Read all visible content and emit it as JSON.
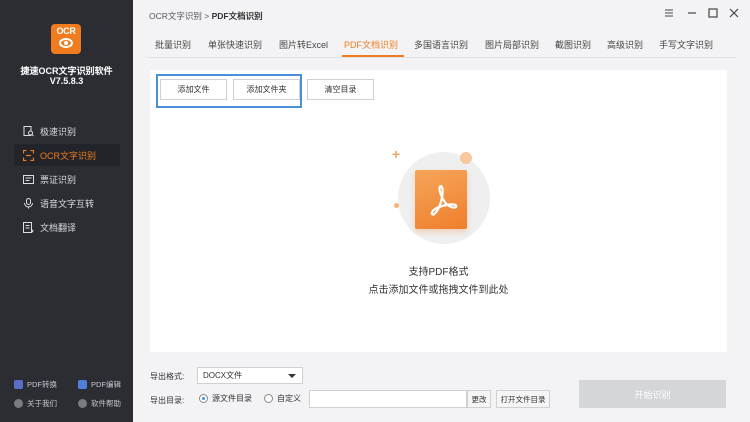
{
  "sidebar": {
    "logo_text": "OCR",
    "app_name": "捷速OCR文字识别软件",
    "version": "V7.5.8.3",
    "items": [
      {
        "label": "极速识别",
        "icon": "doc-search-icon",
        "active": false
      },
      {
        "label": "OCR文字识别",
        "icon": "scan-frame-icon",
        "active": true
      },
      {
        "label": "票证识别",
        "icon": "ticket-icon",
        "active": false
      },
      {
        "label": "语音文字互转",
        "icon": "microphone-icon",
        "active": false
      },
      {
        "label": "文档翻译",
        "icon": "translate-doc-icon",
        "active": false
      }
    ],
    "footer": [
      {
        "label": "PDF转换",
        "icon": "pdf-convert-icon"
      },
      {
        "label": "PDF编辑",
        "icon": "pdf-edit-icon"
      },
      {
        "label": "关于我们",
        "icon": "info-icon"
      },
      {
        "label": "软件帮助",
        "icon": "help-icon"
      }
    ]
  },
  "header": {
    "breadcrumb_root": "OCR文字识别",
    "breadcrumb_sep": ">",
    "breadcrumb_current": "PDF文档识别",
    "window_controls": [
      "menu-icon",
      "minimize-icon",
      "maximize-icon",
      "close-icon"
    ]
  },
  "tabs": [
    {
      "label": "批量识别",
      "active": false
    },
    {
      "label": "单张快速识别",
      "active": false
    },
    {
      "label": "图片转Excel",
      "active": false
    },
    {
      "label": "PDF文档识别",
      "active": true
    },
    {
      "label": "多国语言识别",
      "active": false
    },
    {
      "label": "图片局部识别",
      "active": false
    },
    {
      "label": "截图识别",
      "active": false
    },
    {
      "label": "高级识别",
      "active": false
    },
    {
      "label": "手写文字识别",
      "active": false
    }
  ],
  "toolbar": {
    "add_file": "添加文件",
    "add_folder": "添加文件夹",
    "clear": "清空目录"
  },
  "dropzone": {
    "icon": "pdf-file-icon",
    "line1": "支持PDF格式",
    "line2": "点击添加文件或拖拽文件到此处"
  },
  "bottom": {
    "format_label": "导出格式:",
    "format_value": "DOCX文件",
    "dir_label": "导出目录:",
    "radio_source": "源文件目录",
    "radio_custom": "自定义",
    "path_value": "",
    "change_btn": "更改",
    "open_dir_btn": "打开文件目录",
    "start_btn": "开始识别"
  },
  "colors": {
    "accent": "#f07c1f",
    "sidebar_bg": "#2b2d33",
    "highlight_box": "#4a90d9"
  }
}
